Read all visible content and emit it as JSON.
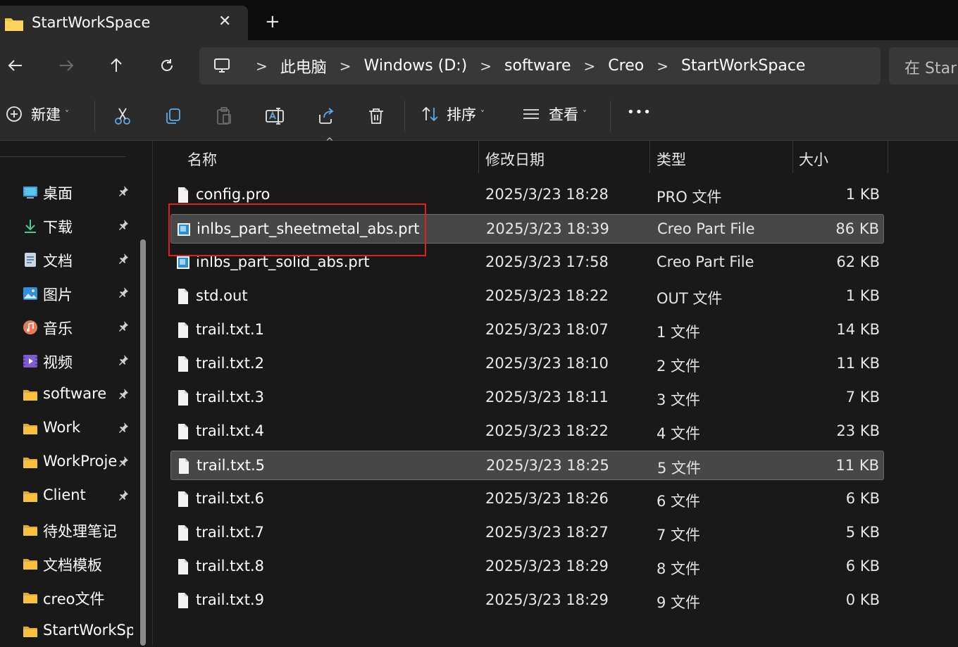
{
  "window": {
    "tab_title": "StartWorkSpace",
    "new_tab": "+",
    "close": "✕"
  },
  "nav": {
    "back": "←",
    "forward": "→",
    "up": "↑",
    "refresh": "↻"
  },
  "address": {
    "crumbs": [
      "此电脑",
      "Windows (D:)",
      "software",
      "Creo",
      "StartWorkSpace"
    ],
    "separator": ">",
    "search_placeholder": "在 Star"
  },
  "toolbar": {
    "new_label": "新建",
    "sort_label": "排序",
    "view_label": "查看",
    "more_label": "•••"
  },
  "sidebar": {
    "items": [
      {
        "label": "桌面",
        "icon": "desktop-icon",
        "pinned": true
      },
      {
        "label": "下载",
        "icon": "download-icon",
        "pinned": true
      },
      {
        "label": "文档",
        "icon": "document-icon",
        "pinned": true
      },
      {
        "label": "图片",
        "icon": "pictures-icon",
        "pinned": true
      },
      {
        "label": "音乐",
        "icon": "music-icon",
        "pinned": true
      },
      {
        "label": "视频",
        "icon": "video-icon",
        "pinned": true
      },
      {
        "label": "software",
        "icon": "folder-icon",
        "pinned": true
      },
      {
        "label": "Work",
        "icon": "folder-icon",
        "pinned": true
      },
      {
        "label": "WorkProje",
        "icon": "folder-icon",
        "pinned": true
      },
      {
        "label": "Client",
        "icon": "folder-icon",
        "pinned": true
      },
      {
        "label": "待处理笔记",
        "icon": "folder-icon",
        "pinned": false
      },
      {
        "label": "文档模板",
        "icon": "folder-icon",
        "pinned": false
      },
      {
        "label": "creo文件",
        "icon": "folder-icon",
        "pinned": false
      },
      {
        "label": "StartWorkSp",
        "icon": "folder-icon",
        "pinned": false
      }
    ],
    "pin_glyph": "📌"
  },
  "columns": {
    "name": "名称",
    "date": "修改日期",
    "type": "类型",
    "size": "大小"
  },
  "files": [
    {
      "name": "config.pro",
      "date": "2025/3/23 18:28",
      "type": "PRO 文件",
      "size": "1 KB",
      "kind": "file",
      "selected": false
    },
    {
      "name": "inlbs_part_sheetmetal_abs.prt",
      "date": "2025/3/23 18:39",
      "type": "Creo Part File",
      "size": "86 KB",
      "kind": "creo",
      "selected": true
    },
    {
      "name": "inlbs_part_solid_abs.prt",
      "date": "2025/3/23 17:58",
      "type": "Creo Part File",
      "size": "62 KB",
      "kind": "creo",
      "selected": false
    },
    {
      "name": "std.out",
      "date": "2025/3/23 18:22",
      "type": "OUT 文件",
      "size": "1 KB",
      "kind": "file",
      "selected": false
    },
    {
      "name": "trail.txt.1",
      "date": "2025/3/23 18:07",
      "type": "1 文件",
      "size": "14 KB",
      "kind": "file",
      "selected": false
    },
    {
      "name": "trail.txt.2",
      "date": "2025/3/23 18:10",
      "type": "2 文件",
      "size": "11 KB",
      "kind": "file",
      "selected": false
    },
    {
      "name": "trail.txt.3",
      "date": "2025/3/23 18:11",
      "type": "3 文件",
      "size": "7 KB",
      "kind": "file",
      "selected": false
    },
    {
      "name": "trail.txt.4",
      "date": "2025/3/23 18:22",
      "type": "4 文件",
      "size": "23 KB",
      "kind": "file",
      "selected": false
    },
    {
      "name": "trail.txt.5",
      "date": "2025/3/23 18:25",
      "type": "5 文件",
      "size": "11 KB",
      "kind": "file",
      "selected": true
    },
    {
      "name": "trail.txt.6",
      "date": "2025/3/23 18:26",
      "type": "6 文件",
      "size": "6 KB",
      "kind": "file",
      "selected": false
    },
    {
      "name": "trail.txt.7",
      "date": "2025/3/23 18:27",
      "type": "7 文件",
      "size": "5 KB",
      "kind": "file",
      "selected": false
    },
    {
      "name": "trail.txt.8",
      "date": "2025/3/23 18:29",
      "type": "8 文件",
      "size": "6 KB",
      "kind": "file",
      "selected": false
    },
    {
      "name": "trail.txt.9",
      "date": "2025/3/23 18:29",
      "type": "9 文件",
      "size": "0 KB",
      "kind": "file",
      "selected": false
    }
  ],
  "colors": {
    "folder": "#f5c242",
    "highlight_box": "#e02020",
    "creo_icon": "#2a8fd8"
  }
}
